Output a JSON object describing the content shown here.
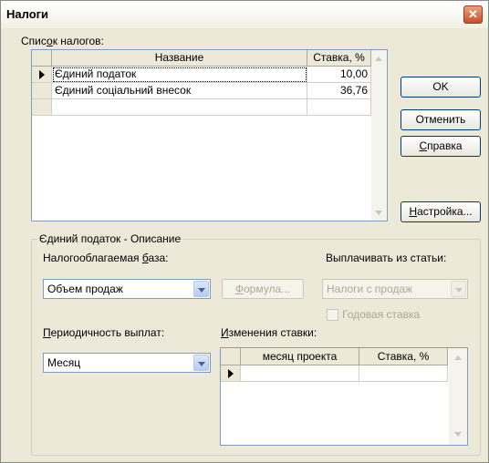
{
  "window": {
    "title": "Налоги"
  },
  "taxes": {
    "list_label_pre": "Спис",
    "list_label_ul": "о",
    "list_label_post": "к налогов:",
    "columns": [
      "Название",
      "Ставка, %"
    ],
    "rows": [
      {
        "name": "Єдиний податок",
        "rate": "10,00"
      },
      {
        "name": "Єдиний соціальний внесок",
        "rate": "36,76"
      }
    ]
  },
  "buttons": {
    "ok": "OK",
    "cancel": "Отменить",
    "help_ul": "С",
    "help_post": "правка",
    "settings_ul": "Н",
    "settings_post": "астройка..."
  },
  "description": {
    "group_title": "Єдиний податок - Описание",
    "base_label_pre": "Налогооблагаемая ",
    "base_label_ul": "б",
    "base_label_post": "аза:",
    "base_value": "Объем продаж",
    "formula_ul": "Ф",
    "formula_post": "ормула...",
    "pay_from_label": "Выплачивать из статьи:",
    "pay_from_value": "Налоги с продаж",
    "annual_rate_label": "Годовая ставка",
    "period_label_ul": "П",
    "period_label_post": "ериодичность выплат:",
    "period_value": "Месяц",
    "changes_label_ul": "И",
    "changes_label_post": "зменения ставки:",
    "changes_columns": [
      "месяц проекта",
      "Ставка, %"
    ]
  }
}
